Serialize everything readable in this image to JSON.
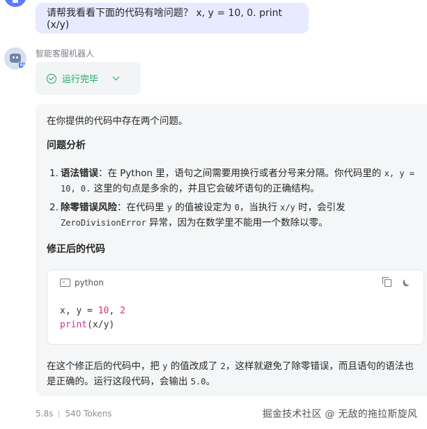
{
  "user_message": {
    "text": "请帮我看看下面的代码有啥问题？ x, y = 10, 0. print (x/y)"
  },
  "bot": {
    "name": "智能客服机器人",
    "avatar_badge": "AI",
    "status": {
      "label": "运行完毕",
      "icon": "check-circle-icon",
      "color": "#19a85d"
    }
  },
  "answer": {
    "intro": "在你提供的代码中存在两个问题。",
    "problems_heading": "问题分析",
    "items": [
      {
        "number": "1.",
        "title": "语法错误",
        "text_a": "：在 Python 里，语句之间需要用换行或者分号来分隔。你代码里的 ",
        "code_a": "x, y = 10, 0.",
        "text_b": " 这里的句点是多余的，并且它会破坏语句的正确结构。"
      },
      {
        "number": "2.",
        "title": "除零错误风险",
        "text_a": "：在代码里 ",
        "code_a": "y",
        "text_b": " 的值被设定为 ",
        "code_b": "0",
        "text_c": "，当执行 ",
        "code_c": "x/y",
        "text_d": " 时，会引发 ",
        "code_d": "ZeroDivisionError",
        "text_e": " 异常，因为在数学里不能用一个数除以零。"
      }
    ],
    "fixed_heading": "修正后的代码",
    "code_block": {
      "language": "python",
      "line1_vars": "x, y = ",
      "line1_num1": "10",
      "line1_comma": ", ",
      "line1_num2": "2",
      "line2_fn": "print",
      "line2_args": "(x/y)"
    },
    "summary": {
      "text_a": "在这个修正后的代码中，把 ",
      "code_a": "y",
      "text_b": " 的值改成了 ",
      "code_b": "2",
      "text_c": "，这样就避免了除零错误，而且语句的语法也是正确的。运行这段代码，会输出 ",
      "code_c": "5.0",
      "text_d": "。"
    }
  },
  "meta": {
    "time": "5.8s",
    "tokens": "540 Tokens"
  },
  "watermark": "掘金技术社区 @ 无敌的拖拉斯旋风",
  "colors": {
    "user_bubble_bg": "#e8ebff",
    "answer_bg": "#f5f6f7",
    "number_literal": "#d6336c"
  }
}
